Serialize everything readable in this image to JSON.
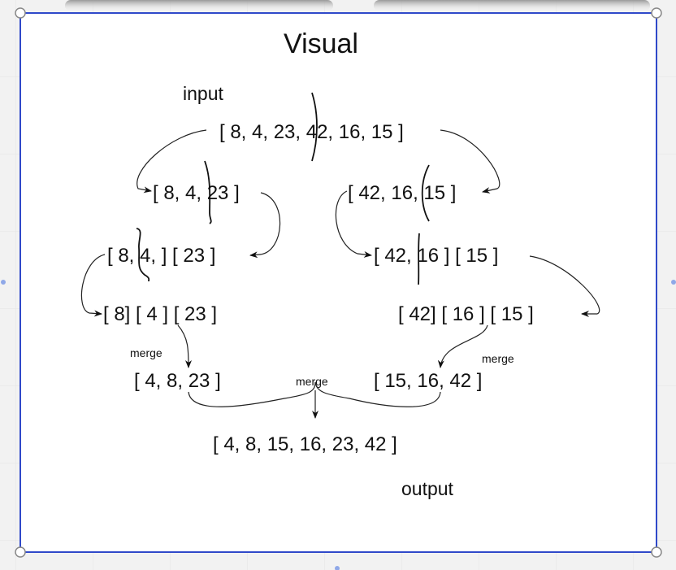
{
  "title": "Visual",
  "input_label": "input",
  "output_label": "output",
  "merge_label": "merge",
  "rows": {
    "input": "[ 8, 4, 23, 42, 16, 15 ]",
    "left_half": "[ 8, 4, 23 ]",
    "right_half": "[ 42, 16, 15 ]",
    "left_split": "[ 8, 4, ] [ 23 ]",
    "right_split": "[ 42, 16 ]  [ 15 ]",
    "left_singles": "[ 8]  [ 4 ]  [ 23 ]",
    "right_singles": "[ 42]  [ 16 ]  [ 15 ]",
    "left_merged": "[ 4, 8, 23 ]",
    "right_merged": "[ 15, 16, 42 ]",
    "output": "[ 4, 8, 15, 16, 23, 42 ]"
  },
  "colors": {
    "frame_border": "#2f49c9",
    "canvas": "#ffffff",
    "background": "#f2f2f2"
  }
}
